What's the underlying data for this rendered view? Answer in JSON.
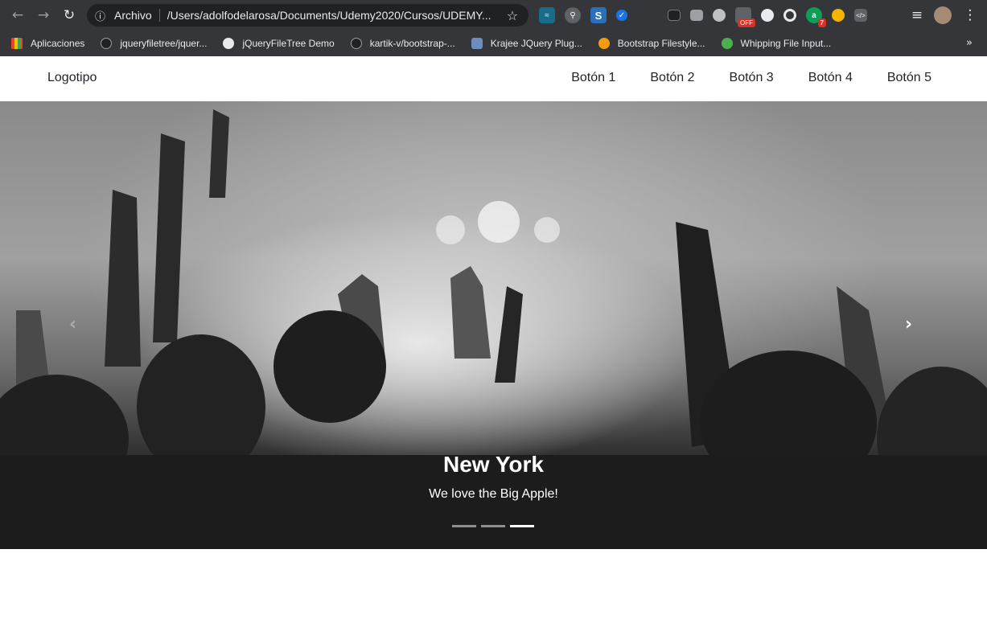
{
  "browser": {
    "address_scheme": "Archivo",
    "address_url": "/Users/adolfodelarosa/Documents/Udemy2020/Cursos/UDEMY...",
    "extension_badge": "7",
    "extension_off_label": "OFF",
    "bookmarks": [
      {
        "label": "Aplicaciones",
        "icon": "apps-grid-icon"
      },
      {
        "label": "jqueryfiletree/jquer...",
        "icon": "github-icon"
      },
      {
        "label": "jQueryFileTree Demo",
        "icon": "globe-icon"
      },
      {
        "label": "kartik-v/bootstrap-...",
        "icon": "github-icon"
      },
      {
        "label": "Krajee JQuery Plug...",
        "icon": "krajee-icon"
      },
      {
        "label": "Bootstrap Filestyle...",
        "icon": "orange-icon"
      },
      {
        "label": "Whipping File Input...",
        "icon": "leaf-icon"
      }
    ],
    "more_bookmarks": "»"
  },
  "site": {
    "logo": "Logotipo",
    "menu": [
      "Botón 1",
      "Botón 2",
      "Botón 3",
      "Botón 4",
      "Botón 5"
    ]
  },
  "carousel": {
    "title": "New York",
    "subtitle": "We love the Big Apple!",
    "slide_count": 3,
    "active_slide": 3,
    "prev_icon": "‹",
    "next_icon": "›"
  }
}
